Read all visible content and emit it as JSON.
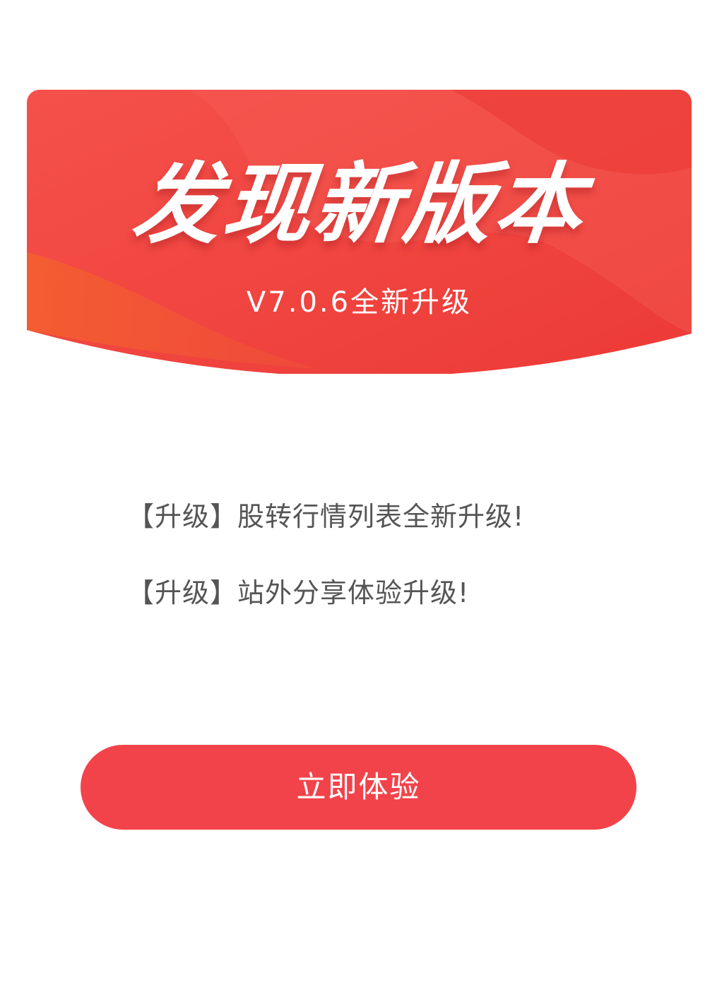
{
  "dialog": {
    "title": "发现新版本",
    "version": "V7.0.6全新升级",
    "notes": [
      "【升级】股转行情列表全新升级!",
      "【升级】站外分享体验升级!"
    ],
    "action_label": "立即体验"
  },
  "colors": {
    "header_red": "#f0443f",
    "button_red": "#f2434a",
    "note_text": "#555555"
  }
}
